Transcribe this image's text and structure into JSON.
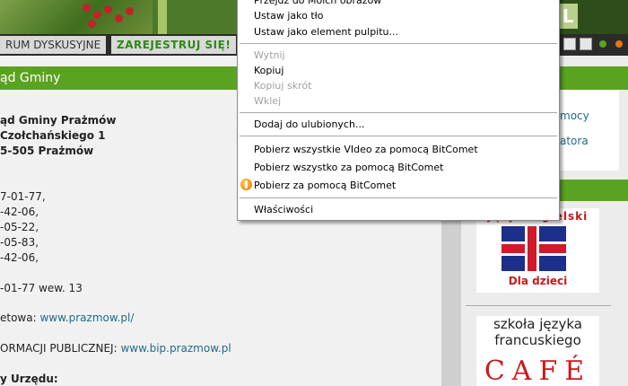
{
  "navbar": {
    "forum_label": "RUM DYSKUSYJNE",
    "register_label": "ZAREJESTRUJ SIĘ!"
  },
  "banner": {
    "logo_letter": "L"
  },
  "content": {
    "section_title": "ąd Gminy",
    "address": [
      "ąd Gminy Prażmów",
      " Czołchańskiego 1",
      "5-505 Prażmów"
    ],
    "phones": [
      "7-01-77,",
      "-42-06,",
      "-05-22,",
      "-05-83,",
      "-42-06,"
    ],
    "fax": "-01-77 wew. 13",
    "web_prefix": "etowa: ",
    "web_link": "www.prazmow.pl/",
    "bip_prefix": "ORMACJI PUBLICZNEJ: ",
    "bip_link": "www.bip.prazmow.pl",
    "hours_label": "y Urzędu:"
  },
  "sidebar": {
    "link_1": "mocy",
    "link_2": "atora"
  },
  "ads": {
    "english_title": "JęzykAngielski",
    "english_sub": "Dla dzieci",
    "french_line1": "szkoła języka",
    "french_line2": "francuskiego",
    "french_cafe": "CAFÉ"
  },
  "context_menu": {
    "items": [
      {
        "label": "Przejdź do Moich obrazów",
        "disabled": false
      },
      {
        "label": "Ustaw jako tło",
        "disabled": false
      },
      {
        "label": "Ustaw jako element pulpitu...",
        "disabled": false
      },
      {
        "label": "Wytnij",
        "disabled": true
      },
      {
        "label": "Kopiuj",
        "disabled": false
      },
      {
        "label": "Kopiuj skrót",
        "disabled": true
      },
      {
        "label": "Wklej",
        "disabled": true
      },
      {
        "label": "Dodaj do ulubionych...",
        "disabled": false
      },
      {
        "label": "Pobierz wszystkie VIdeo za pomocą BitComet",
        "disabled": false
      },
      {
        "label": "Pobierz wszystko za pomocą BitComet",
        "disabled": false
      },
      {
        "label": "Pobierz za pomocą BitComet",
        "disabled": false
      },
      {
        "label": "Właściwości",
        "disabled": false
      }
    ]
  },
  "colors": {
    "green_header": "#5aa320",
    "link": "#1e6b8a",
    "register_text": "#2e8a14",
    "ad_red": "#c81a1a"
  }
}
